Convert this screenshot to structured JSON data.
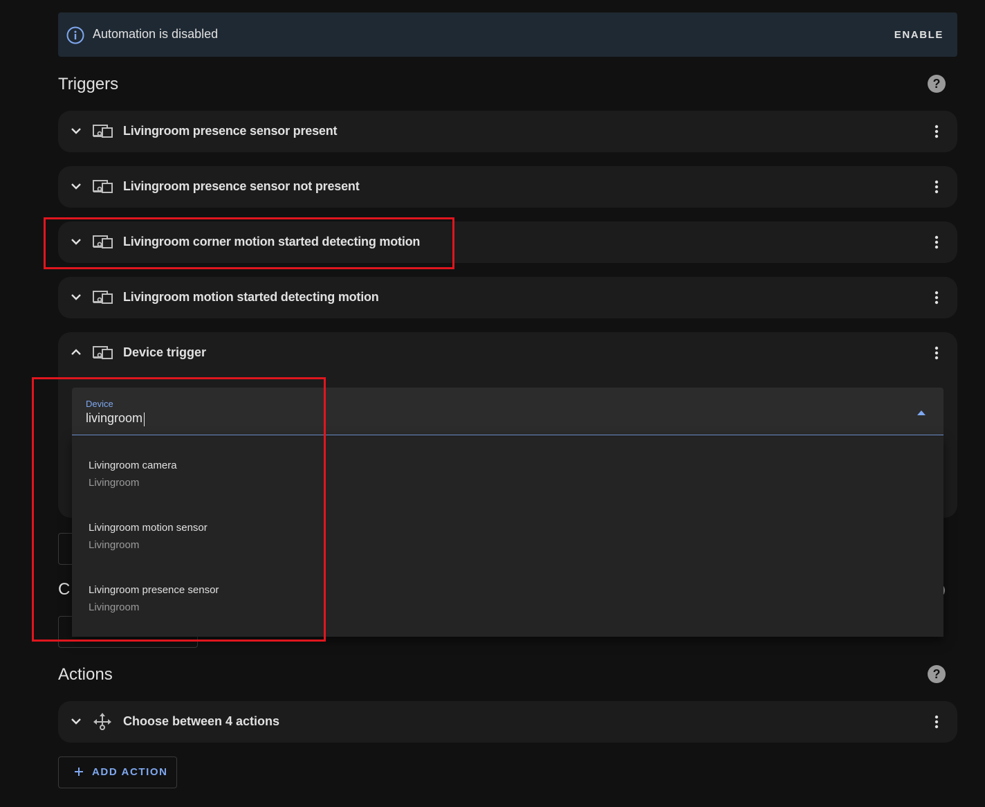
{
  "banner": {
    "text": "Automation is disabled",
    "action_label": "ENABLE",
    "icon": "info-circle-icon"
  },
  "triggers": {
    "title": "Triggers",
    "items": [
      {
        "label": "Livingroom presence sensor present",
        "icon": "device-icon",
        "expanded": false
      },
      {
        "label": "Livingroom presence sensor not present",
        "icon": "device-icon",
        "expanded": false
      },
      {
        "label": "Livingroom corner motion started detecting motion",
        "icon": "device-icon",
        "expanded": false
      },
      {
        "label": "Livingroom motion started detecting motion",
        "icon": "device-icon",
        "expanded": false
      },
      {
        "label": "Device trigger",
        "icon": "device-icon",
        "expanded": true
      }
    ]
  },
  "device_field": {
    "label": "Device",
    "value": "livingroom"
  },
  "device_options": [
    {
      "name": "Livingroom camera",
      "area": "Livingroom"
    },
    {
      "name": "Livingroom motion sensor",
      "area": "Livingroom"
    },
    {
      "name": "Livingroom presence sensor",
      "area": "Livingroom"
    }
  ],
  "conditions": {
    "title_visible": "C"
  },
  "actions": {
    "title": "Actions",
    "items": [
      {
        "label": "Choose between 4 actions",
        "icon": "choose-arrows-icon"
      }
    ],
    "add_label": "ADD ACTION"
  },
  "colors": {
    "background": "#111111",
    "card": "#1c1c1c",
    "banner": "#1f2933",
    "accent": "#7fa8f0",
    "annotation": "#e0161e"
  }
}
